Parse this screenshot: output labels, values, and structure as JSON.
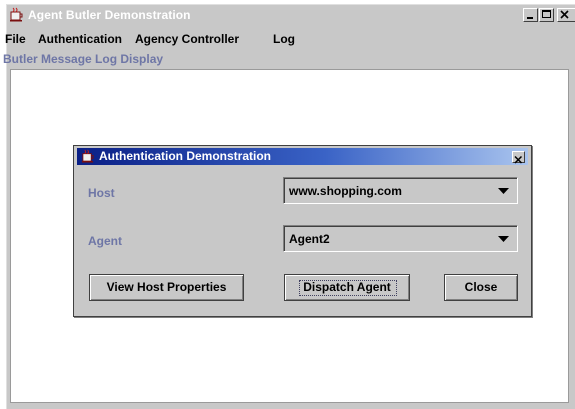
{
  "window": {
    "title": "Agent Butler Demonstration",
    "controls": [
      "minimize",
      "maximize",
      "close"
    ]
  },
  "menu": {
    "items": [
      "File",
      "Authentication",
      "Agency Controller",
      "Log"
    ]
  },
  "log": {
    "label": "Butler Message Log Display"
  },
  "dialog": {
    "title": "Authentication Demonstration",
    "host_label": "Host",
    "host_value": "www.shopping.com",
    "agent_label": "Agent",
    "agent_value": "Agent2",
    "buttons": {
      "view_host": "View Host Properties",
      "dispatch": "Dispatch Agent",
      "close": "Close"
    },
    "focused_button": "dispatch"
  },
  "colors": {
    "window_bg": "#c8c8c8",
    "label_blue": "#6e76a6",
    "dialog_title_start": "#0a1f86",
    "dialog_title_end": "#a9c4ee"
  },
  "icons": {
    "app": "java-coffee-cup-icon",
    "dialog": "java-coffee-cup-icon",
    "combo": "chevron-down-icon"
  }
}
